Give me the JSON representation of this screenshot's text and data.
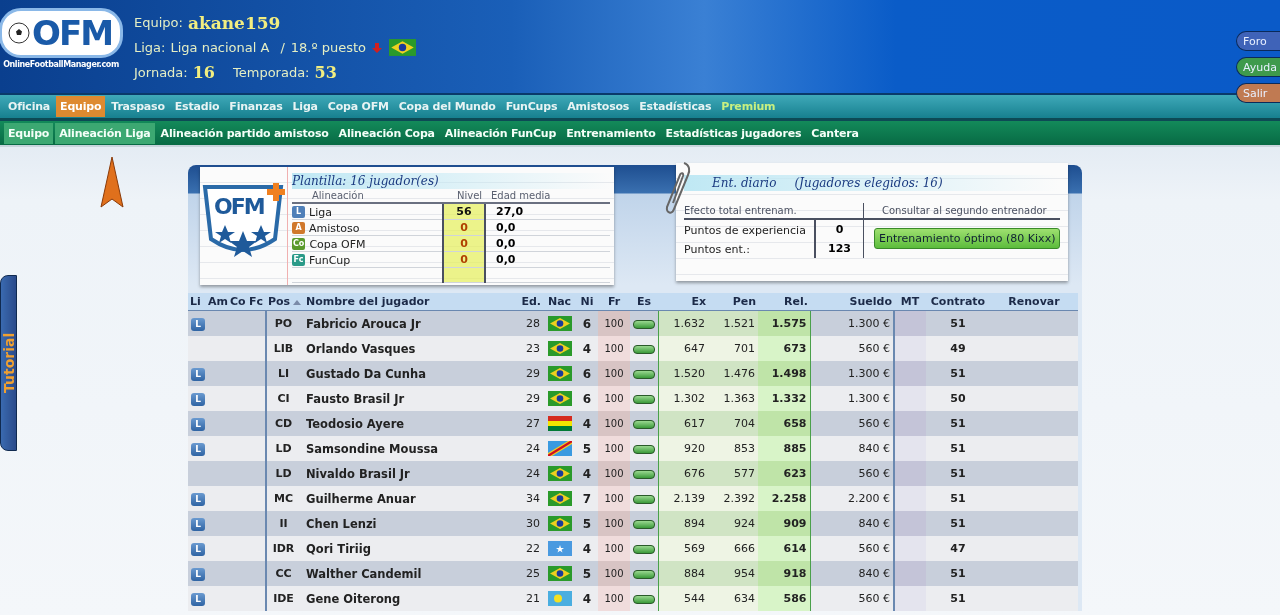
{
  "header": {
    "logo_text": "OFM",
    "site_name": "OnlineFootballManager.com",
    "team_label": "Equipo:",
    "team": "akane159",
    "league_label": "Liga:",
    "league": "Liga nacional A",
    "separator": "/",
    "position": "18.º puesto",
    "matchday_label": "Jornada:",
    "matchday": "16",
    "season_label": "Temporada:",
    "season": "53"
  },
  "side_buttons": [
    {
      "label": "Foro",
      "color": "#3f63b8"
    },
    {
      "label": "Ayuda",
      "color": "#3f9a4c"
    },
    {
      "label": "Salir",
      "color": "#c07a52"
    }
  ],
  "main_nav": [
    {
      "label": "Oficina",
      "selected": false,
      "kind": "link"
    },
    {
      "label": "Equipo",
      "selected": true,
      "kind": "link"
    },
    {
      "label": "Traspaso",
      "selected": false,
      "kind": "link"
    },
    {
      "label": "Estadio",
      "selected": false,
      "kind": "link"
    },
    {
      "label": "Finanzas",
      "selected": false,
      "kind": "link"
    },
    {
      "label": "Liga",
      "selected": false,
      "kind": "link"
    },
    {
      "label": "Copa OFM",
      "selected": false,
      "kind": "link"
    },
    {
      "label": "Copa del Mundo",
      "selected": false,
      "kind": "link"
    },
    {
      "label": "FunCups",
      "selected": false,
      "kind": "link"
    },
    {
      "label": "Amistosos",
      "selected": false,
      "kind": "link"
    },
    {
      "label": "Estadísticas",
      "selected": false,
      "kind": "link"
    },
    {
      "label": "Premium",
      "selected": false,
      "kind": "premium"
    }
  ],
  "sub_nav": [
    {
      "label": "Equipo",
      "selected": true
    },
    {
      "label": "Alineación Liga",
      "selected": true
    },
    {
      "label": "Alineación partido amistoso",
      "selected": false
    },
    {
      "label": "Alineación Copa",
      "selected": false
    },
    {
      "label": "Alineación FunCup",
      "selected": false
    },
    {
      "label": "Entrenamiento",
      "selected": false
    },
    {
      "label": "Estadísticas jugadores",
      "selected": false
    },
    {
      "label": "Cantera",
      "selected": false
    }
  ],
  "tutorial_tab": {
    "label": "Tutorial"
  },
  "squad_card": {
    "logo_text": "OFM",
    "title": "Plantilla: 16 jugador(es)",
    "columns": [
      "Alineación",
      "Nivel",
      "Edad media"
    ],
    "rows": [
      {
        "badge": "L",
        "color": "#4f7fb8",
        "name": "Liga",
        "nivel": "56",
        "average_age": "27,0",
        "active": true
      },
      {
        "badge": "A",
        "color": "#d0782c",
        "name": "Amistoso",
        "nivel": "0",
        "average_age": "0,0",
        "active": false
      },
      {
        "badge": "Co",
        "color": "#5a9a2c",
        "name": "Copa OFM",
        "nivel": "0",
        "average_age": "0,0",
        "active": false
      },
      {
        "badge": "Fc",
        "color": "#2a9a88",
        "name": "FunCup",
        "nivel": "0",
        "average_age": "0,0",
        "active": false
      }
    ]
  },
  "training_card": {
    "title": "Ent. diario",
    "subtitle": "(Jugadores elegidos: 16)",
    "columns": [
      "Efecto total entrenam.",
      "Consultar al segundo entrenador"
    ],
    "rows": [
      {
        "label": "Puntos de experiencia",
        "value": "0"
      },
      {
        "label": "Puntos ent.:",
        "value": "123"
      }
    ],
    "button": "Entrenamiento óptimo (80 Kixx)"
  },
  "players": {
    "columns": [
      {
        "label": "Li",
        "sorted": false
      },
      {
        "label": "Am",
        "sorted": false
      },
      {
        "label": "Co",
        "sorted": false
      },
      {
        "label": "Fc",
        "sorted": false
      },
      {
        "label": "Pos",
        "sorted": true
      },
      {
        "label": "Nombre del jugador",
        "sorted": false
      },
      {
        "label": "Ed.",
        "sorted": false
      },
      {
        "label": "Nac",
        "sorted": false
      },
      {
        "label": "Ni",
        "sorted": false
      },
      {
        "label": "Fr",
        "sorted": false
      },
      {
        "label": "Es",
        "sorted": false
      },
      {
        "label": "Ex",
        "sorted": false
      },
      {
        "label": "Pen",
        "sorted": false
      },
      {
        "label": "Rel.",
        "sorted": false
      },
      {
        "label": "Sueldo",
        "sorted": false
      },
      {
        "label": "MT",
        "sorted": false
      },
      {
        "label": "Contrato",
        "sorted": false
      },
      {
        "label": "Renovar",
        "sorted": false
      }
    ],
    "rows": [
      {
        "li": "L",
        "position": "PO",
        "name": "Fabricio Arouca Jr",
        "age": "28",
        "kind": "brazil",
        "ni": "6",
        "fr": "100",
        "ex": "1.632",
        "pen": "1.521",
        "rel": "1.575",
        "salary": "1.300 €",
        "contract": "51"
      },
      {
        "position": "LIB",
        "name": "Orlando Vasques",
        "age": "23",
        "kind": "brazil",
        "ni": "4",
        "fr": "100",
        "ex": "647",
        "pen": "701",
        "rel": "673",
        "salary": "560 €",
        "contract": "49"
      },
      {
        "li": "L",
        "position": "LI",
        "name": "Gustado Da Cunha",
        "age": "29",
        "kind": "brazil",
        "ni": "6",
        "fr": "100",
        "ex": "1.520",
        "pen": "1.476",
        "rel": "1.498",
        "salary": "1.300 €",
        "contract": "51"
      },
      {
        "li": "L",
        "position": "CI",
        "name": "Fausto Brasil Jr",
        "age": "29",
        "kind": "brazil",
        "ni": "6",
        "fr": "100",
        "ex": "1.302",
        "pen": "1.363",
        "rel": "1.332",
        "salary": "1.300 €",
        "contract": "50"
      },
      {
        "li": "L",
        "position": "CD",
        "name": "Teodosio Ayere",
        "age": "27",
        "kind": "bolivia",
        "ni": "4",
        "fr": "100",
        "ex": "617",
        "pen": "704",
        "rel": "658",
        "salary": "560 €",
        "contract": "51"
      },
      {
        "li": "L",
        "position": "LD",
        "name": "Samsondine Moussa",
        "age": "24",
        "kind": "congo",
        "ni": "5",
        "fr": "100",
        "ex": "920",
        "pen": "853",
        "rel": "885",
        "salary": "840 €",
        "contract": "51"
      },
      {
        "position": "LD",
        "name": "Nivaldo Brasil Jr",
        "age": "24",
        "kind": "brazil",
        "ni": "4",
        "fr": "100",
        "ex": "676",
        "pen": "577",
        "rel": "623",
        "salary": "560 €",
        "contract": "51"
      },
      {
        "li": "L",
        "position": "MC",
        "name": "Guilherme Anuar",
        "age": "34",
        "kind": "brazil",
        "ni": "7",
        "fr": "100",
        "ex": "2.139",
        "pen": "2.392",
        "rel": "2.258",
        "salary": "2.200 €",
        "contract": "51"
      },
      {
        "li": "L",
        "position": "II",
        "name": "Chen Lenzi",
        "age": "30",
        "kind": "brazil",
        "ni": "5",
        "fr": "100",
        "ex": "894",
        "pen": "924",
        "rel": "909",
        "salary": "840 €",
        "contract": "51"
      },
      {
        "li": "L",
        "position": "IDR",
        "name": "Qori Tiriig",
        "age": "22",
        "kind": "somalia",
        "ni": "4",
        "fr": "100",
        "ex": "569",
        "pen": "666",
        "rel": "614",
        "salary": "560 €",
        "contract": "47"
      },
      {
        "li": "L",
        "position": "CC",
        "name": "Walther Candemil",
        "age": "25",
        "kind": "brazil",
        "ni": "5",
        "fr": "100",
        "ex": "884",
        "pen": "954",
        "rel": "918",
        "salary": "840 €",
        "contract": "51"
      },
      {
        "li": "L",
        "position": "IDE",
        "name": "Gene Oiterong",
        "age": "21",
        "kind": "palau",
        "ni": "4",
        "fr": "100",
        "ex": "544",
        "pen": "634",
        "rel": "586",
        "salary": "560 €",
        "contract": "51"
      }
    ]
  }
}
